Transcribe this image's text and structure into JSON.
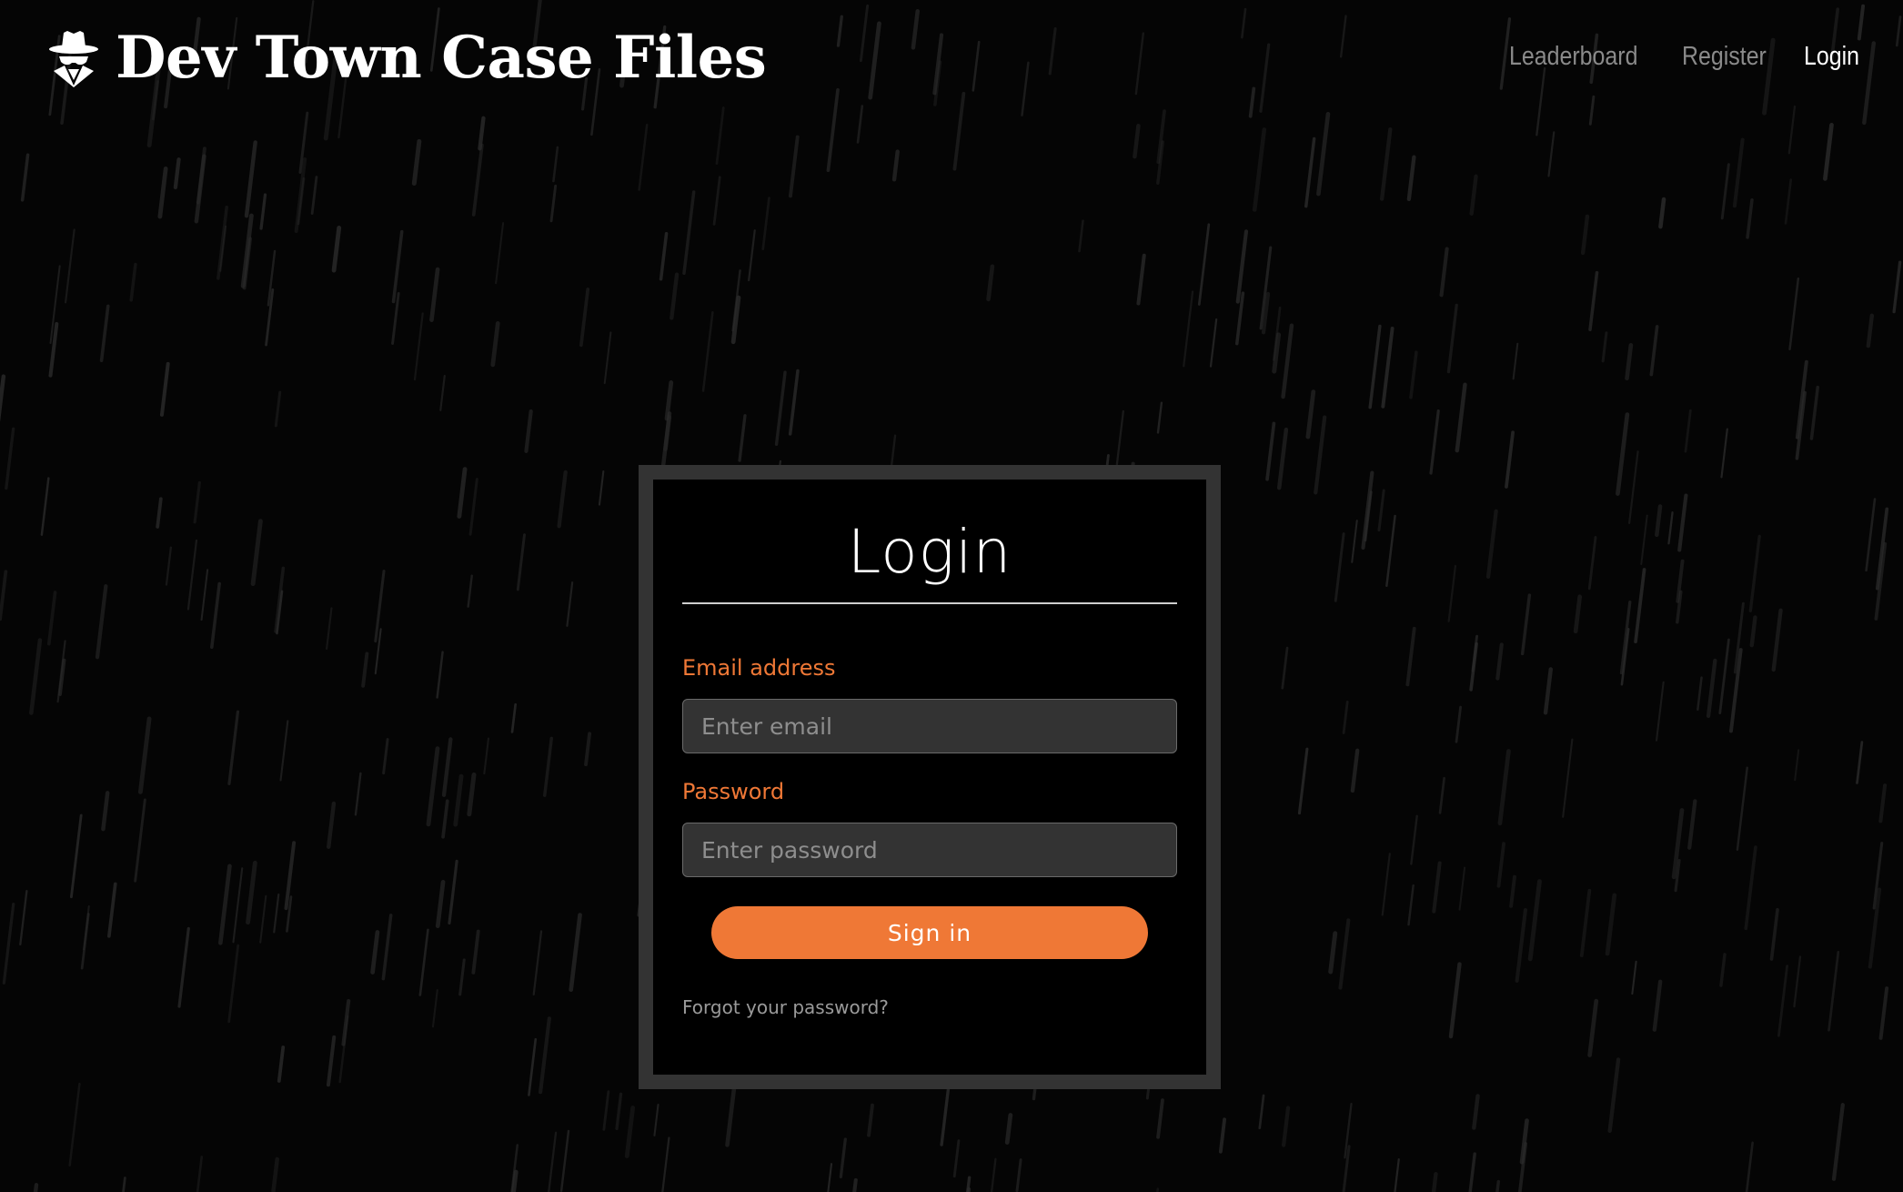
{
  "brand": {
    "title": "Dev Town Case Files",
    "icon": "detective-icon"
  },
  "nav": {
    "links": [
      {
        "label": "Leaderboard",
        "active": false
      },
      {
        "label": "Register",
        "active": false
      },
      {
        "label": "Login",
        "active": true
      }
    ]
  },
  "login": {
    "title": "Login",
    "email_label": "Email address",
    "email_placeholder": "Enter email",
    "email_value": "",
    "password_label": "Password",
    "password_placeholder": "Enter password",
    "password_value": "",
    "submit_label": "Sign in",
    "forgot_label": "Forgot your password?"
  },
  "colors": {
    "background": "#050505",
    "accent": "#ef7836",
    "card_border": "#333333",
    "input_background": "#333333",
    "nav_inactive": "#8a8a8a",
    "nav_active": "#ffffff"
  }
}
